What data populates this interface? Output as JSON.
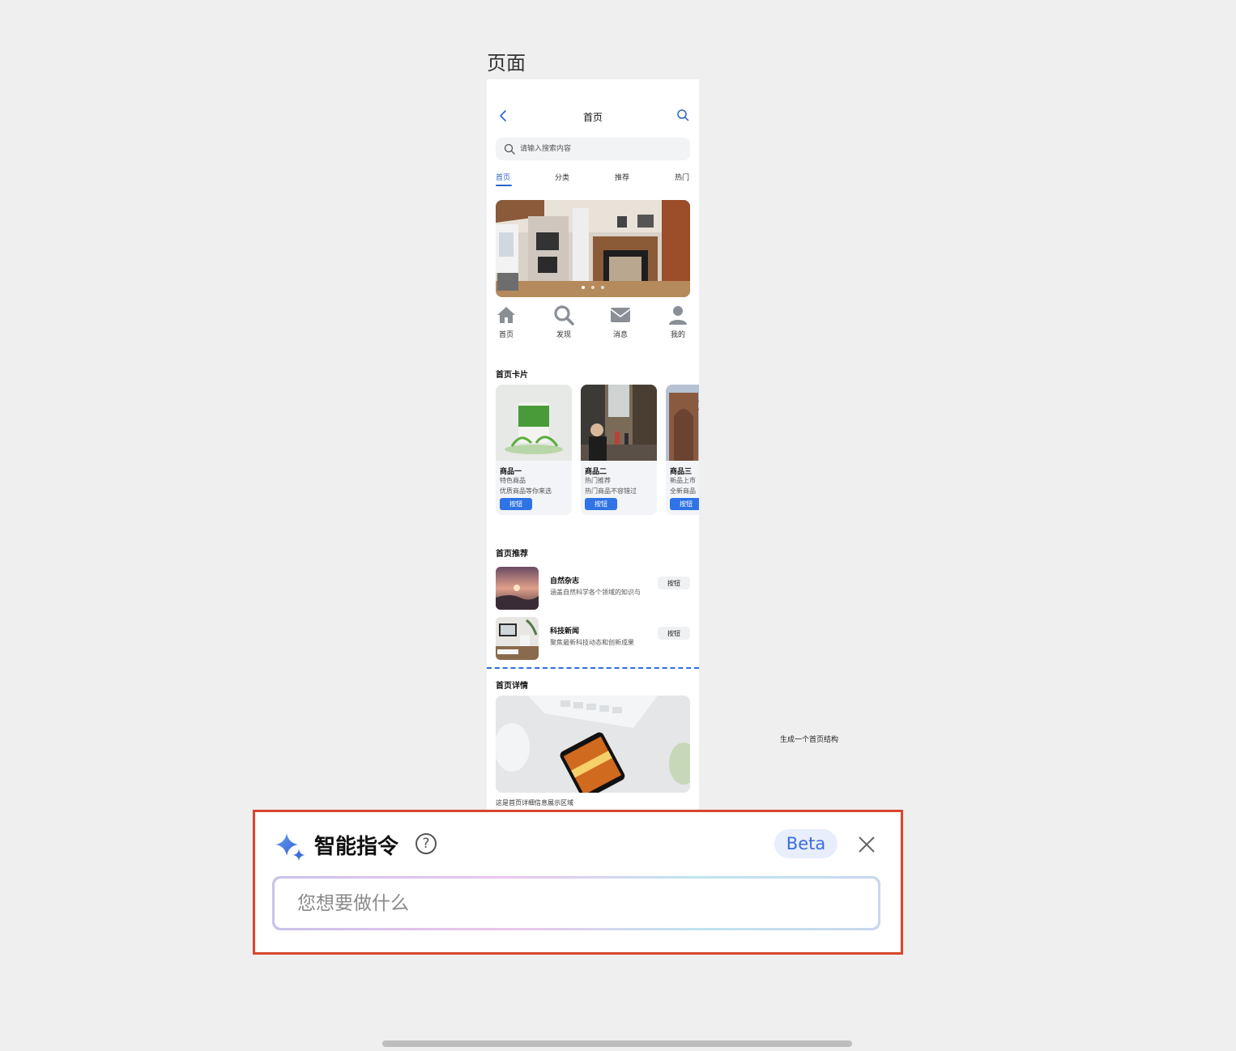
{
  "canvas": {
    "page_label": "页面",
    "side_note": "生成一个首页结构"
  },
  "phone": {
    "nav_title": "首页",
    "search_placeholder": "请输入搜索内容",
    "tabs": [
      "首页",
      "分类",
      "推荐",
      "热门"
    ],
    "quick_items": [
      {
        "label": "首页",
        "icon": "home-icon"
      },
      {
        "label": "发现",
        "icon": "search-icon"
      },
      {
        "label": "消息",
        "icon": "mail-icon"
      },
      {
        "label": "我的",
        "icon": "user-icon"
      }
    ],
    "cards_title": "首页卡片",
    "cards": [
      {
        "title": "商品一",
        "sub1": "特色商品",
        "sub2": "优质商品等你来选",
        "button": "按钮"
      },
      {
        "title": "商品二",
        "sub1": "热门推荐",
        "sub2": "热门商品不容错过",
        "button": "按钮"
      },
      {
        "title": "商品三",
        "sub1": "新品上市",
        "sub2": "全新商品",
        "button": "按钮"
      }
    ],
    "recommend_title": "首页推荐",
    "recommend": [
      {
        "title": "自然杂志",
        "desc": "涵盖自然科学各个领域的知识与",
        "button": "按钮"
      },
      {
        "title": "科技新闻",
        "desc": "聚焦最新科技动态和创新成果",
        "button": "按钮"
      }
    ],
    "detail_title": "首页详情",
    "detail_text": "这是首页详细信息展示区域"
  },
  "panel": {
    "title": "智能指令",
    "help": "?",
    "badge": "Beta",
    "input_placeholder": "您想要做什么",
    "colors": {
      "border": "#d9452e",
      "accent": "#3d6ddc"
    }
  }
}
